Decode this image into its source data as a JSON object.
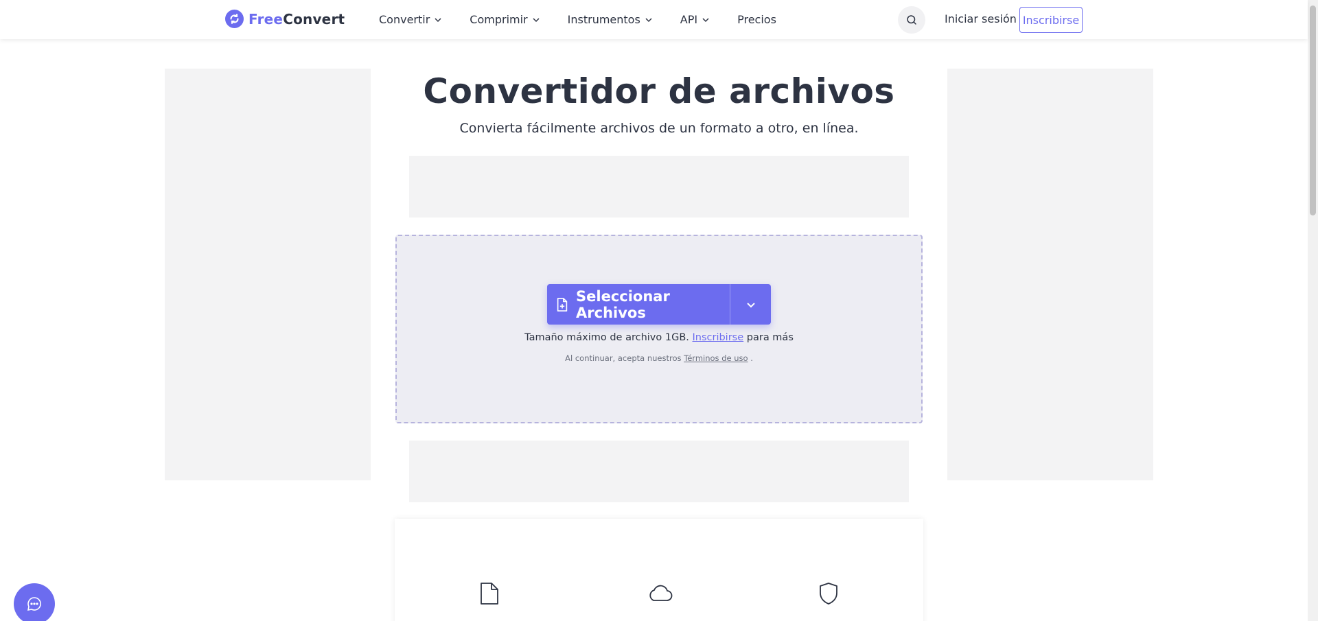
{
  "header": {
    "logo": {
      "free": "Free",
      "convert": "Convert"
    },
    "nav": [
      {
        "label": "Convertir",
        "has_dropdown": true
      },
      {
        "label": "Comprimir",
        "has_dropdown": true
      },
      {
        "label": "Instrumentos",
        "has_dropdown": true
      },
      {
        "label": "API",
        "has_dropdown": true
      },
      {
        "label": "Precios",
        "has_dropdown": false
      }
    ],
    "login_label": "Iniciar sesión",
    "signup_label": "Inscribirse"
  },
  "main": {
    "title": "Convertidor de archivos",
    "subtitle": "Convierta fácilmente archivos de un formato a otro, en línea."
  },
  "upload": {
    "button_label": "Seleccionar Archivos",
    "max_size_prefix": "Tamaño máximo de archivo 1GB.",
    "max_size_link": "Inscribirse",
    "max_size_suffix": "para más",
    "terms_prefix": "Al continuar, acepta nuestros",
    "terms_link": "Términos de uso",
    "terms_suffix": "."
  },
  "features": [
    {
      "icon": "file-icon"
    },
    {
      "icon": "cloud-icon"
    },
    {
      "icon": "shield-icon"
    }
  ],
  "colors": {
    "accent": "#6c6cef",
    "text": "#2d3342",
    "ad_placeholder": "#f3f3f4",
    "upload_bg": "#ededf3"
  }
}
